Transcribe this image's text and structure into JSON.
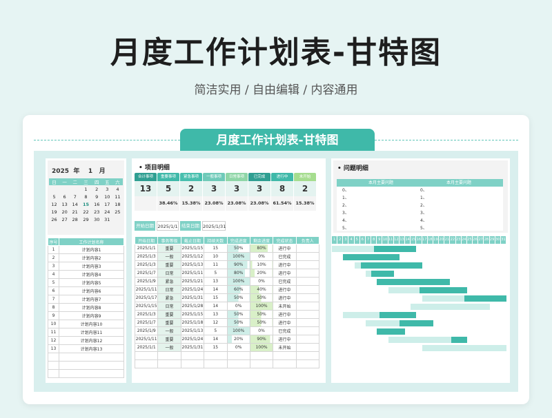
{
  "hero": {
    "title": "月度工作计划表-甘特图",
    "subtitle": "简洁实用 / 自由编辑 / 内容通用"
  },
  "banner": {
    "title": "月度工作计划表-甘特图"
  },
  "calendar": {
    "year": "2025",
    "year_suffix": "年",
    "month": "1",
    "month_suffix": "月",
    "weekdays": [
      "日",
      "一",
      "二",
      "三",
      "四",
      "五",
      "六"
    ],
    "weeks": [
      [
        "",
        "",
        "",
        "1",
        "2",
        "3",
        "4"
      ],
      [
        "5",
        "6",
        "7",
        "8",
        "9",
        "10",
        "11"
      ],
      [
        "12",
        "13",
        "14",
        "15",
        "16",
        "17",
        "18"
      ],
      [
        "19",
        "20",
        "21",
        "22",
        "23",
        "24",
        "25"
      ],
      [
        "26",
        "27",
        "28",
        "29",
        "30",
        "31",
        ""
      ]
    ],
    "today": "15"
  },
  "task_list": {
    "headers": [
      "序号",
      "工作计划名称"
    ],
    "rows": [
      [
        "1",
        "计划内容1"
      ],
      [
        "2",
        "计划内容2"
      ],
      [
        "3",
        "计划内容3"
      ],
      [
        "4",
        "计划内容4"
      ],
      [
        "5",
        "计划内容5"
      ],
      [
        "6",
        "计划内容6"
      ],
      [
        "7",
        "计划内容7"
      ],
      [
        "8",
        "计划内容8"
      ],
      [
        "9",
        "计划内容9"
      ],
      [
        "10",
        "计划内容10"
      ],
      [
        "11",
        "计划内容11"
      ],
      [
        "12",
        "计划内容12"
      ],
      [
        "13",
        "计划内容13"
      ],
      [
        "",
        ""
      ],
      [
        "",
        ""
      ],
      [
        "",
        ""
      ]
    ]
  },
  "project": {
    "title": "项目明细",
    "kpis": [
      {
        "label": "合计事项",
        "value": "13",
        "pct": "",
        "color": "#2f9f92"
      },
      {
        "label": "重要事项",
        "value": "5",
        "pct": "38.46%",
        "color": "#3fb9a9"
      },
      {
        "label": "紧急事项",
        "value": "2",
        "pct": "15.38%",
        "color": "#47bfae"
      },
      {
        "label": "一般事项",
        "value": "3",
        "pct": "23.08%",
        "color": "#6fcab9"
      },
      {
        "label": "日常事项",
        "value": "3",
        "pct": "23.08%",
        "color": "#8fd6a7"
      },
      {
        "label": "已完成",
        "value": "3",
        "pct": "23.08%",
        "color": "#2f9f92"
      },
      {
        "label": "进行中",
        "value": "8",
        "pct": "61.54%",
        "color": "#3fb9a9"
      },
      {
        "label": "未开始",
        "value": "2",
        "pct": "15.38%",
        "color": "#a6dd8f"
      }
    ],
    "start_label": "开始日期",
    "start_value": "2025/1/1",
    "end_label": "结束日期",
    "end_value": "2025/1/31",
    "headers": [
      "开始日期",
      "事务等级",
      "截止日期",
      "持续天数",
      "完成进度",
      "剩余进度",
      "完成状态",
      "负责人"
    ],
    "rows": [
      [
        "2025/1/1",
        "重要",
        "2025/1/15",
        "15",
        "50%",
        "80%",
        "进行中",
        ""
      ],
      [
        "2025/1/3",
        "一般",
        "2025/1/12",
        "10",
        "100%",
        "0%",
        "已完成",
        ""
      ],
      [
        "2025/1/3",
        "重要",
        "2025/1/13",
        "11",
        "90%",
        "10%",
        "进行中",
        ""
      ],
      [
        "2025/1/7",
        "日常",
        "2025/1/11",
        "5",
        "80%",
        "20%",
        "进行中",
        ""
      ],
      [
        "2025/1/9",
        "紧急",
        "2025/1/21",
        "13",
        "100%",
        "0%",
        "已完成",
        ""
      ],
      [
        "2025/1/11",
        "日常",
        "2025/1/24",
        "14",
        "60%",
        "40%",
        "进行中",
        ""
      ],
      [
        "2025/1/17",
        "紧急",
        "2025/1/31",
        "15",
        "50%",
        "50%",
        "进行中",
        ""
      ],
      [
        "2025/1/15",
        "日常",
        "2025/1/28",
        "14",
        "0%",
        "100%",
        "未开始",
        ""
      ],
      [
        "2025/1/3",
        "重要",
        "2025/1/15",
        "13",
        "50%",
        "50%",
        "进行中",
        ""
      ],
      [
        "2025/1/7",
        "重要",
        "2025/1/18",
        "12",
        "50%",
        "50%",
        "进行中",
        ""
      ],
      [
        "2025/1/9",
        "一般",
        "2025/1/13",
        "5",
        "100%",
        "0%",
        "已完成",
        ""
      ],
      [
        "2025/1/11",
        "重要",
        "2025/1/24",
        "14",
        "20%",
        "90%",
        "进行中",
        ""
      ],
      [
        "2025/1/1",
        "一般",
        "2025/1/31",
        "15",
        "0%",
        "100%",
        "未开始",
        ""
      ],
      [
        "",
        "",
        "",
        "",
        "",
        "",
        "",
        ""
      ],
      [
        "",
        "",
        "",
        "",
        "",
        "",
        "",
        ""
      ]
    ]
  },
  "issues": {
    "title": "问题明细",
    "lists": [
      {
        "header": "本月主要问题",
        "items": [
          "0、",
          "1、",
          "2、",
          "3、",
          "4、",
          "5、"
        ]
      },
      {
        "header": "本月主要问题",
        "items": [
          "0、",
          "1、",
          "2、",
          "3、",
          "4、",
          "5、"
        ]
      }
    ]
  },
  "gantt": {
    "days": [
      "1",
      "2",
      "3",
      "4",
      "5",
      "6",
      "7",
      "8",
      "9",
      "10",
      "11",
      "12",
      "13",
      "14",
      "15",
      "16",
      "17",
      "18",
      "19",
      "20",
      "21",
      "22",
      "23",
      "24",
      "25",
      "26",
      "27",
      "28",
      "29",
      "30",
      "31"
    ],
    "tasks": [
      {
        "start": 1,
        "end": 15,
        "progress": 0.5
      },
      {
        "start": 3,
        "end": 12,
        "progress": 1.0
      },
      {
        "start": 5,
        "end": 16,
        "progress": 0.9
      },
      {
        "start": 7,
        "end": 11,
        "progress": 0.8
      },
      {
        "start": 9,
        "end": 21,
        "progress": 1.0
      },
      {
        "start": 11,
        "end": 24,
        "progress": 0.6
      },
      {
        "start": 17,
        "end": 31,
        "progress": 0.5
      },
      {
        "start": 15,
        "end": 28,
        "progress": 0.0
      },
      {
        "start": 3,
        "end": 15,
        "progress": 0.5
      },
      {
        "start": 7,
        "end": 18,
        "progress": 0.5
      },
      {
        "start": 9,
        "end": 13,
        "progress": 1.0
      },
      {
        "start": 11,
        "end": 24,
        "progress": 0.2
      },
      {
        "start": 17,
        "end": 31,
        "progress": 0.0
      }
    ],
    "colors": {
      "done": "#3fb9a9",
      "remain": "#cdeee9"
    }
  }
}
